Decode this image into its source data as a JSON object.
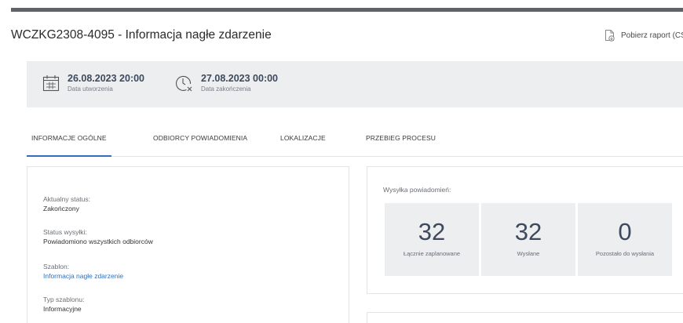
{
  "header": {
    "title": "WCZKG2308-4095 - Informacja nagłe zdarzenie",
    "report_label": "Pobierz raport (CSV)"
  },
  "dates": {
    "created": {
      "value": "26.08.2023 20:00",
      "label": "Data utworzenia"
    },
    "finished": {
      "value": "27.08.2023 00:00",
      "label": "Data zakończenia"
    }
  },
  "tabs": [
    {
      "label": "INFORMACJE OGÓLNE",
      "active": true
    },
    {
      "label": "ODBIORCY POWIADOMIENIA",
      "active": false
    },
    {
      "label": "LOKALIZACJE",
      "active": false
    },
    {
      "label": "PRZEBIEG PROCESU",
      "active": false
    }
  ],
  "status_card": {
    "current_status": {
      "label": "Aktualny status:",
      "value": "Zakończony"
    },
    "send_status": {
      "label": "Status wysyłki:",
      "value": "Powiadomiono wszystkich odbiorców"
    },
    "template": {
      "label": "Szablon:",
      "value": "Informacja nagłe zdarzenie"
    },
    "template_type": {
      "label": "Typ szablonu:",
      "value": "Informacyjne"
    }
  },
  "stats": {
    "title": "Wysyłka powiadomień:",
    "items": [
      {
        "number": "32",
        "label": "Łącznie zaplanowane"
      },
      {
        "number": "32",
        "label": "Wysłane"
      },
      {
        "number": "0",
        "label": "Pozostało do wysłania"
      }
    ]
  },
  "colors": {
    "accent": "#2f6fbd",
    "panel_bg": "#eceef0",
    "number_color": "#3e4a5c",
    "top_bar": "#5f6266"
  },
  "icons": {
    "report": "document-download-icon",
    "created": "calendar-icon",
    "finished": "clock-x-icon"
  }
}
